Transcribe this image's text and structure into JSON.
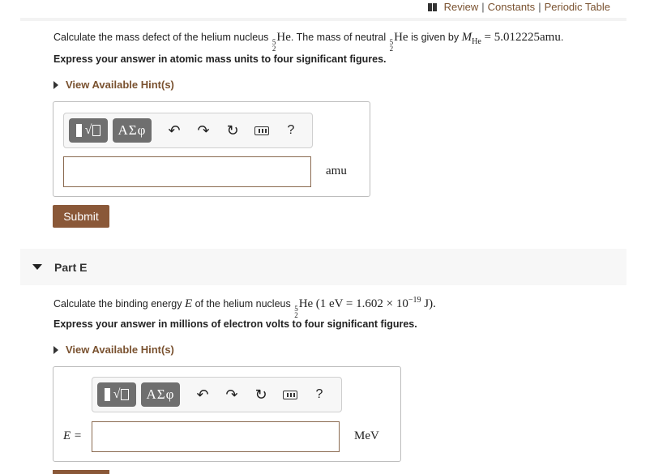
{
  "header": {
    "review": "Review",
    "constants": "Constants",
    "periodic_table": "Periodic Table",
    "separator": "|"
  },
  "part_d": {
    "question_prefix": "Calculate the mass defect of the helium nucleus",
    "question_mid": ". The mass of neutral",
    "question_suffix": "is given by",
    "mass_symbol": "M",
    "mass_subscript": "He",
    "mass_value": "= 5.012225amu",
    "period": ".",
    "nucleus": {
      "mass_number": "5",
      "atomic_number": "2",
      "symbol": "He"
    },
    "instruction": "Express your answer in atomic mass units to four significant figures.",
    "hint": "View Available Hint(s)",
    "unit": "amu",
    "submit": "Submit",
    "input_value": ""
  },
  "part_e": {
    "label": "Part E",
    "question_prefix": "Calculate the binding energy",
    "energy_symbol": "E",
    "question_mid": "of the helium nucleus",
    "conversion": "(1 eV = 1.602 × 10",
    "exponent": "−19",
    "conversion_end": "J).",
    "instruction": "Express your answer in millions of electron volts to four significant figures.",
    "hint": "View Available Hint(s)",
    "input_label": "E =",
    "unit": "MeV",
    "input_value": ""
  },
  "toolbar": {
    "greek": "ΑΣφ",
    "undo": "↶",
    "redo": "↷",
    "reset": "↻",
    "help": "?",
    "icons": [
      "template-icon",
      "greek-icon",
      "undo-icon",
      "redo-icon",
      "reset-icon",
      "keyboard-icon",
      "help-icon"
    ]
  },
  "colors": {
    "accent": "#8a5838",
    "link": "#7a5230",
    "tool": "#6f6f6f"
  }
}
